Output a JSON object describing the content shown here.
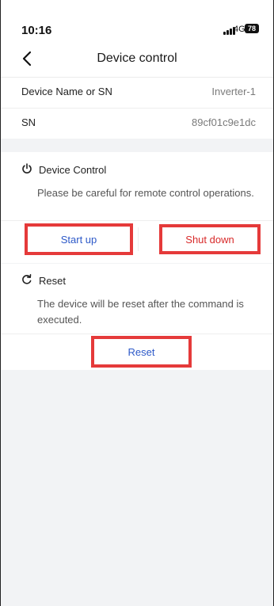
{
  "status": {
    "time": "10:16",
    "network": "4G",
    "battery": "78"
  },
  "nav": {
    "title": "Device control",
    "back_icon": "chevron-left-icon"
  },
  "info": {
    "rows": [
      {
        "label": "Device Name or SN",
        "value": "Inverter-1"
      },
      {
        "label": "SN",
        "value": "89cf01c9e1dc"
      }
    ]
  },
  "device_control": {
    "title": "Device Control",
    "icon": "power-icon",
    "description": "Please be careful for remote control operations.",
    "start_label": "Start up",
    "shutdown_label": "Shut down"
  },
  "reset": {
    "title": "Reset",
    "icon": "refresh-icon",
    "description": "The device will be reset after the command is executed.",
    "button_label": "Reset"
  },
  "colors": {
    "accent_blue": "#2d59c8",
    "danger_red": "#d82a2a",
    "highlight_border": "#e53a3a",
    "background": "#f2f3f5"
  }
}
